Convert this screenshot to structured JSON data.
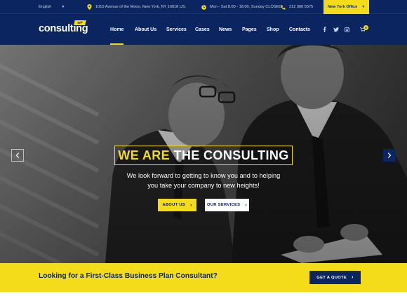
{
  "topbar": {
    "language": "English",
    "address": "1010 Avenue of the Moon, New York, NY 10018 US.",
    "hours": "Mon - Sat 8.00 - 18.00, Sunday CLOSED",
    "phone": "212 386 5575",
    "office": "New York Office"
  },
  "nav": {
    "logo": "consulting",
    "logo_badge": "WP",
    "menu": [
      "Home",
      "About Us",
      "Services",
      "Cases",
      "News",
      "Pages",
      "Shop",
      "Contacts"
    ],
    "active_item": "Home",
    "cart_count": "0"
  },
  "hero": {
    "headline_highlight": "WE ARE",
    "headline_rest": "THE CONSULTING",
    "tagline_line1": "We look forward to getting to know you and to helping",
    "tagline_line2": "you take your company to new heights!",
    "btn_about": "ABOUT US",
    "btn_services": "OUR SERVICES"
  },
  "cta": {
    "text": "Looking for a First-Class Business Plan Consultant?",
    "button": "GET A QUOTE"
  },
  "colors": {
    "navy": "#0b2560",
    "yellow": "#f5dc1a"
  },
  "icons": [
    "chevron-down-icon",
    "map-pin-icon",
    "clock-icon",
    "phone-icon",
    "facebook-icon",
    "twitter-icon",
    "instagram-icon",
    "cart-icon",
    "chevron-left-icon",
    "chevron-right-icon"
  ]
}
